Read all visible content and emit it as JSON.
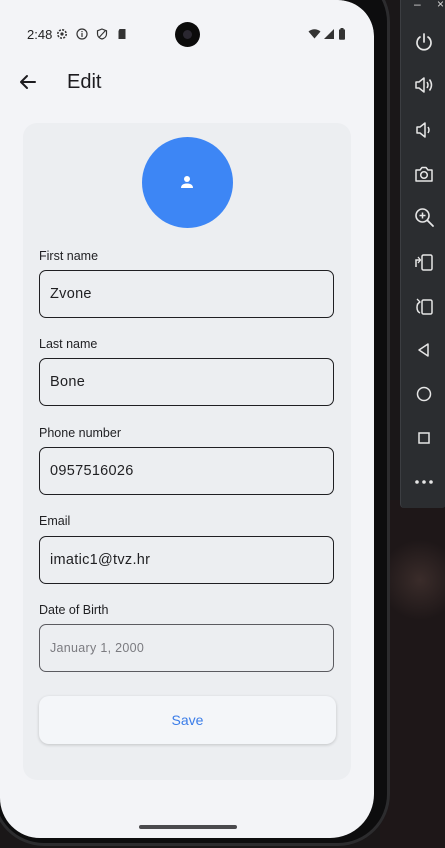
{
  "status_bar": {
    "time": "2:48"
  },
  "app_bar": {
    "title": "Edit"
  },
  "form": {
    "first_name_label": "First name",
    "first_name_value": "Zvone",
    "last_name_label": "Last name",
    "last_name_value": "Bone",
    "phone_label": "Phone number",
    "phone_value": "0957516026",
    "email_label": "Email",
    "email_value": "imatic1@tvz.hr",
    "dob_label": "Date of Birth",
    "dob_placeholder": "January 1, 2000",
    "save_label": "Save"
  },
  "emulator_toolbar": {
    "minimize": "–",
    "close": "×",
    "buttons": [
      "power-icon",
      "volume-up-icon",
      "volume-down-icon",
      "camera-icon",
      "zoom-in-icon",
      "rotate-left-icon",
      "rotate-right-icon",
      "back-icon",
      "home-icon",
      "overview-icon",
      "more-icon"
    ]
  },
  "colors": {
    "accent": "#3d86f5",
    "save_text": "#3b7de8",
    "screen_bg": "#f3f4f7",
    "card_bg": "#eceef1"
  }
}
